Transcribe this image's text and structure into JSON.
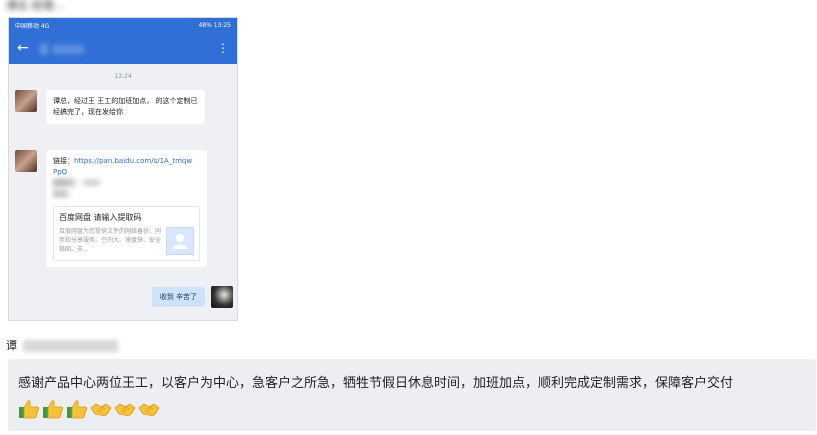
{
  "top_label": "谭总      经理...",
  "phone": {
    "status_left": "中国移动 4G",
    "status_right": "48% 13:25",
    "header_title": "王   33333",
    "back_icon": "arrow-left-icon",
    "more_icon": "more-vertical-icon",
    "timestamp": "13:24",
    "message1": "谭总，经过王  王工的加班加点，      的这个定制已经搞完了，现在发给你",
    "message2": {
      "link_prefix": "链接：",
      "link_text": "https://pan.baidu.com/s/1A_tmqw                  PpQ",
      "code_line": "提取码：   nm4",
      "extra_line": "来自：         ",
      "card_title": "百度网盘 请输入提取码",
      "card_desc": "百度网盘为您提供文件的网络备份、同步和分享服务。空间大、速度快、安全稳固、支..."
    },
    "reply": "收到 辛苦了"
  },
  "author_label": "谭",
  "comment": {
    "text": "感谢产品中心两位王工，以客户为中心，急客户之所急，牺牲节假日休息时间，加班加点，顺利完成定制需求，保障客户交付",
    "emojis": [
      "thumbs-up-icon",
      "thumbs-up-icon",
      "thumbs-up-icon",
      "handshake-icon",
      "handshake-icon",
      "handshake-icon"
    ]
  }
}
